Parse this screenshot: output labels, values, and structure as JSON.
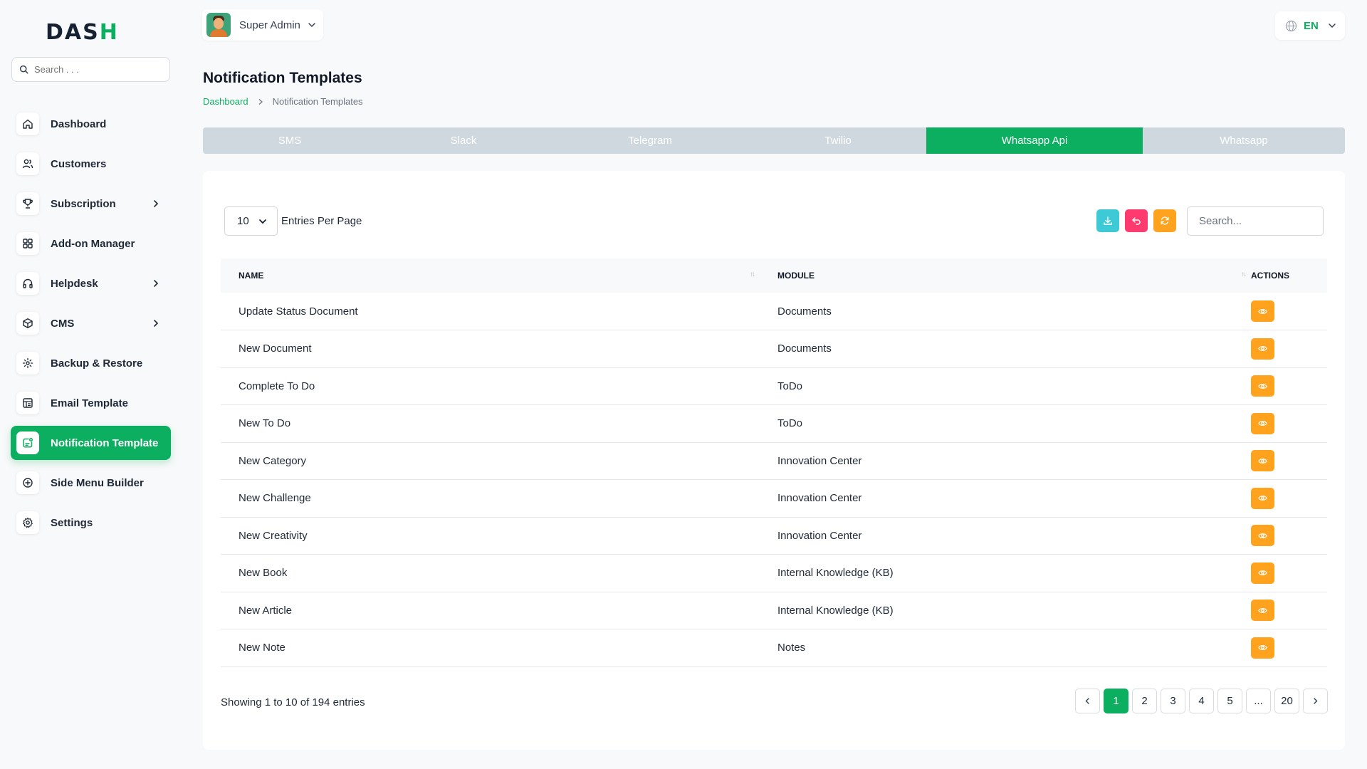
{
  "brand": {
    "logo_text_a": "DAS",
    "logo_text_b": "H",
    "accent_color": "#0caf60"
  },
  "sidebar": {
    "search_placeholder": "Search . . .",
    "items": [
      {
        "label": "Dashboard",
        "icon": "home-icon",
        "has_submenu": false,
        "active": false
      },
      {
        "label": "Customers",
        "icon": "users-icon",
        "has_submenu": false,
        "active": false
      },
      {
        "label": "Subscription",
        "icon": "trophy-icon",
        "has_submenu": true,
        "active": false
      },
      {
        "label": "Add-on Manager",
        "icon": "grid-icon",
        "has_submenu": false,
        "active": false
      },
      {
        "label": "Helpdesk",
        "icon": "headphones-icon",
        "has_submenu": true,
        "active": false
      },
      {
        "label": "CMS",
        "icon": "package-icon",
        "has_submenu": true,
        "active": false
      },
      {
        "label": "Backup & Restore",
        "icon": "backup-icon",
        "has_submenu": false,
        "active": false
      },
      {
        "label": "Email Template",
        "icon": "template-icon",
        "has_submenu": false,
        "active": false
      },
      {
        "label": "Notification Template",
        "icon": "notification-icon",
        "has_submenu": false,
        "active": true
      },
      {
        "label": "Side Menu Builder",
        "icon": "plus-circle-icon",
        "has_submenu": false,
        "active": false
      },
      {
        "label": "Settings",
        "icon": "gear-icon",
        "has_submenu": false,
        "active": false
      }
    ]
  },
  "header": {
    "user_name": "Super Admin",
    "language": "EN"
  },
  "page": {
    "title": "Notification Templates",
    "breadcrumb_home": "Dashboard",
    "breadcrumb_current": "Notification Templates"
  },
  "tabs": [
    {
      "label": "SMS",
      "active": false
    },
    {
      "label": "Slack",
      "active": false
    },
    {
      "label": "Telegram",
      "active": false
    },
    {
      "label": "Twilio",
      "active": false
    },
    {
      "label": "Whatsapp Api",
      "active": true
    },
    {
      "label": "Whatsapp",
      "active": false
    }
  ],
  "table": {
    "per_page": "10",
    "per_page_label": "Entries Per Page",
    "search_placeholder": "Search...",
    "columns": {
      "name": "NAME",
      "module": "MODULE",
      "actions": "ACTIONS"
    },
    "rows": [
      {
        "name": "Update Status Document",
        "module": "Documents"
      },
      {
        "name": "New Document",
        "module": "Documents"
      },
      {
        "name": "Complete To Do",
        "module": "ToDo"
      },
      {
        "name": "New To Do",
        "module": "ToDo"
      },
      {
        "name": "New Category",
        "module": "Innovation Center"
      },
      {
        "name": "New Challenge",
        "module": "Innovation Center"
      },
      {
        "name": "New Creativity",
        "module": "Innovation Center"
      },
      {
        "name": "New Book",
        "module": "Internal Knowledge (KB)"
      },
      {
        "name": "New Article",
        "module": "Internal Knowledge (KB)"
      },
      {
        "name": "New Note",
        "module": "Notes"
      }
    ],
    "showing_text": "Showing 1 to 10 of 194 entries",
    "pages": [
      "1",
      "2",
      "3",
      "4",
      "5",
      "...",
      "20"
    ],
    "current_page": "1"
  },
  "colors": {
    "download": "#3ec9d6",
    "undo": "#ff3a6e",
    "refresh": "#ffa21d",
    "view": "#ffa21d",
    "tab_inactive": "#cfd8de"
  }
}
